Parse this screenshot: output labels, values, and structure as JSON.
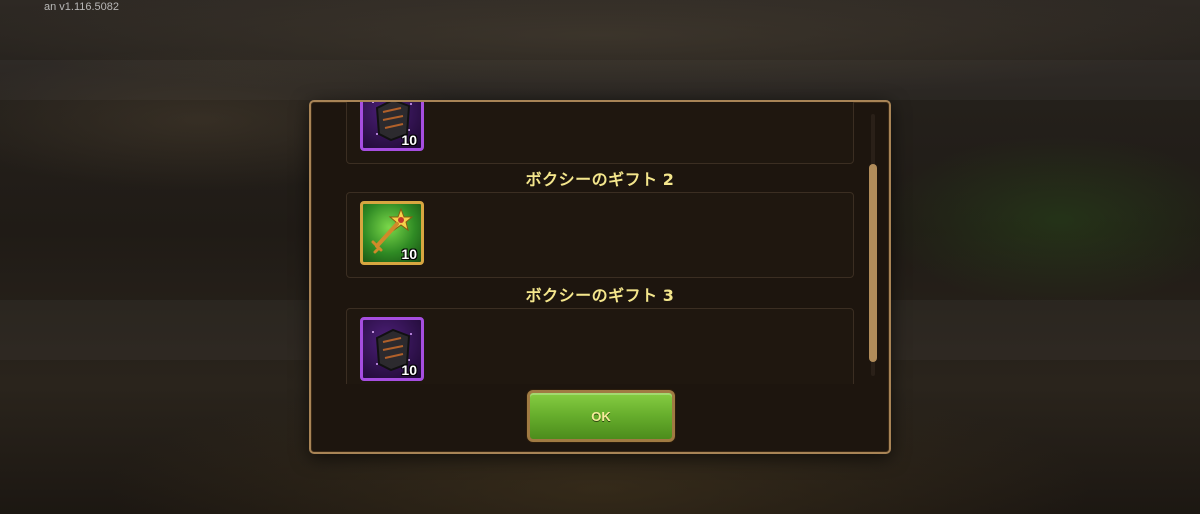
{
  "version_label": "an v1.116.5082",
  "dialog": {
    "gifts": [
      {
        "title": "",
        "item": {
          "icon": "dark-armor-icon",
          "rarity_color": "#a64ee0",
          "count": "10"
        }
      },
      {
        "title": "ボクシーのギフト",
        "number": "2",
        "item": {
          "icon": "golden-key-icon",
          "rarity_color": "#d7a640",
          "count": "10"
        }
      },
      {
        "title": "ボクシーのギフト",
        "number": "3",
        "item": {
          "icon": "dark-armor-icon",
          "rarity_color": "#a64ee0",
          "count": "10"
        }
      }
    ],
    "ok_label": "OK"
  },
  "colors": {
    "title_text": "#f4e68c",
    "button_green": "#66ad2c",
    "frame_gold": "#a88456"
  }
}
